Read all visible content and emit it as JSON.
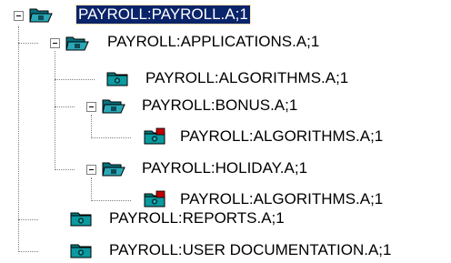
{
  "tree": {
    "nodes": [
      {
        "label": "PAYROLL:PAYROLL.A;1",
        "icon": "open-folder-icon",
        "expanded": true,
        "selected": true
      },
      {
        "label": "PAYROLL:APPLICATIONS.A;1",
        "icon": "open-folder-icon",
        "expanded": true,
        "selected": false
      },
      {
        "label": "PAYROLL:ALGORITHMS.A;1",
        "icon": "closed-folder-icon",
        "selected": false
      },
      {
        "label": "PAYROLL:BONUS.A;1",
        "icon": "open-folder-icon",
        "expanded": true,
        "selected": false
      },
      {
        "label": "PAYROLL:ALGORITHMS.A;1",
        "icon": "closed-folder-with-red-badge-icon",
        "selected": false
      },
      {
        "label": "PAYROLL:HOLIDAY.A;1",
        "icon": "open-folder-icon",
        "expanded": true,
        "selected": false
      },
      {
        "label": "PAYROLL:ALGORITHMS.A;1",
        "icon": "closed-folder-with-red-badge-icon",
        "selected": false
      },
      {
        "label": "PAYROLL:REPORTS.A;1",
        "icon": "closed-folder-icon",
        "selected": false
      },
      {
        "label": "PAYROLL:USER DOCUMENTATION.A;1",
        "icon": "closed-folder-icon",
        "selected": false
      }
    ]
  },
  "colors": {
    "selection_bg": "#0a246a",
    "folder_teal": "#008080",
    "badge_red": "#c00000",
    "tree_lines": "#808080"
  }
}
